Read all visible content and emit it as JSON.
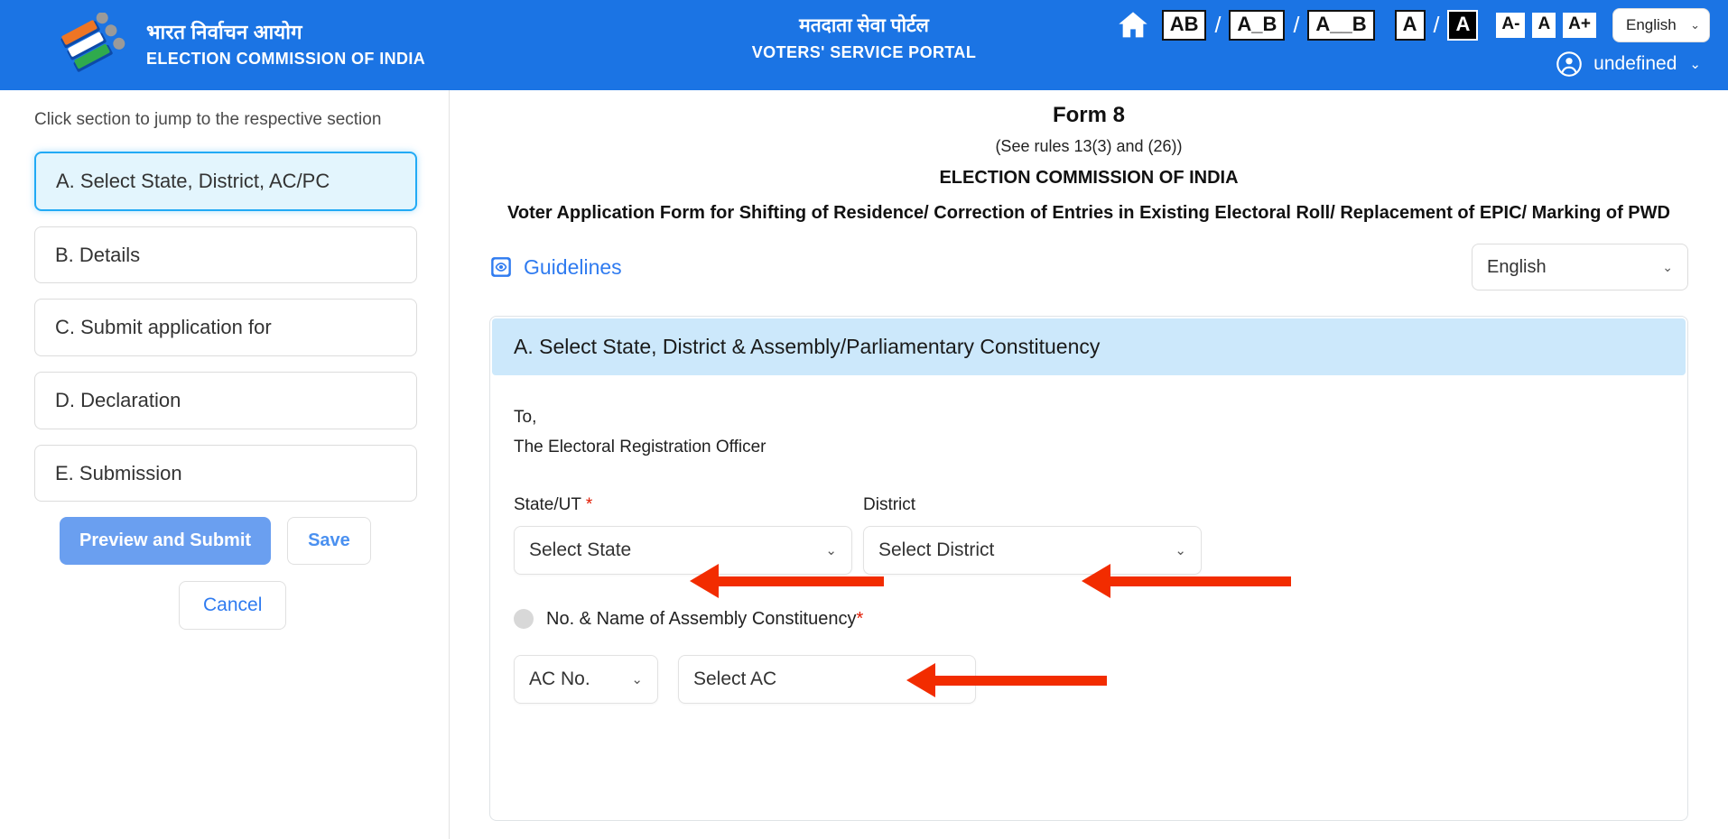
{
  "header": {
    "logo_icon": "eci-ballot-logo",
    "brand_hindi": "भारत निर्वाचन आयोग",
    "brand_english": "ELECTION COMMISSION OF INDIA",
    "portal_hindi": "मतदाता सेवा पोर्टल",
    "portal_english": "VOTERS' SERVICE PORTAL",
    "home_icon": "home-icon",
    "accessibility": {
      "spacing_normal": "AB",
      "spacing_sep1": "/",
      "spacing_medium": "A_B",
      "spacing_sep2": "/",
      "spacing_wide": "A__B",
      "contrast_normal": "A",
      "contrast_sep": "/",
      "contrast_invert": "A",
      "font_decrease": "A-",
      "font_default": "A",
      "font_increase": "A+"
    },
    "language": {
      "value": "English",
      "chevron": "⌄"
    },
    "user": {
      "icon": "user-circle-icon",
      "name": "undefined",
      "chevron": "⌄"
    }
  },
  "sidebar": {
    "hint": "Click section to jump to the respective section",
    "items": [
      {
        "label": "A. Select State, District, AC/PC",
        "active": true
      },
      {
        "label": "B. Details",
        "active": false
      },
      {
        "label": "C. Submit application for",
        "active": false
      },
      {
        "label": "D. Declaration",
        "active": false
      },
      {
        "label": "E. Submission",
        "active": false
      }
    ],
    "preview_submit_label": "Preview and Submit",
    "save_label": "Save",
    "cancel_label": "Cancel"
  },
  "form": {
    "title": "Form 8",
    "rules": "(See rules 13(3) and (26))",
    "authority": "ELECTION COMMISSION OF INDIA",
    "subtitle": "Voter Application Form for Shifting of Residence/ Correction of Entries in Existing Electoral Roll/ Replacement of EPIC/ Marking of PWD",
    "guidelines_label": "Guidelines",
    "guidelines_icon": "eye-guidelines-icon",
    "language_value": "English",
    "language_chevron": "⌄"
  },
  "section_a": {
    "heading": "A. Select State, District & Assembly/Parliamentary Constituency",
    "to_line1": "To,",
    "to_line2": "The Electoral Registration Officer",
    "state": {
      "label": "State/UT",
      "required_mark": "*",
      "value": "Select State",
      "chevron": "⌄"
    },
    "district": {
      "label": "District",
      "value": "Select District",
      "chevron": "⌄"
    },
    "assembly": {
      "radio_label": "No. & Name of Assembly Constituency",
      "required_mark": "*",
      "ac_no": {
        "value": "AC No.",
        "chevron": "⌄"
      },
      "ac_name": {
        "value": "Select AC",
        "chevron": "⌄"
      }
    }
  },
  "colors": {
    "header_blue": "#1b74e4",
    "section_band": "#cce8fb",
    "active_item_bg": "#e3f5fd",
    "active_item_border": "#22aaf5",
    "primary_button": "#6a9ff0",
    "link_blue": "#2f7bf0",
    "annotation_red": "#f22c00",
    "required_red": "#e11900"
  }
}
